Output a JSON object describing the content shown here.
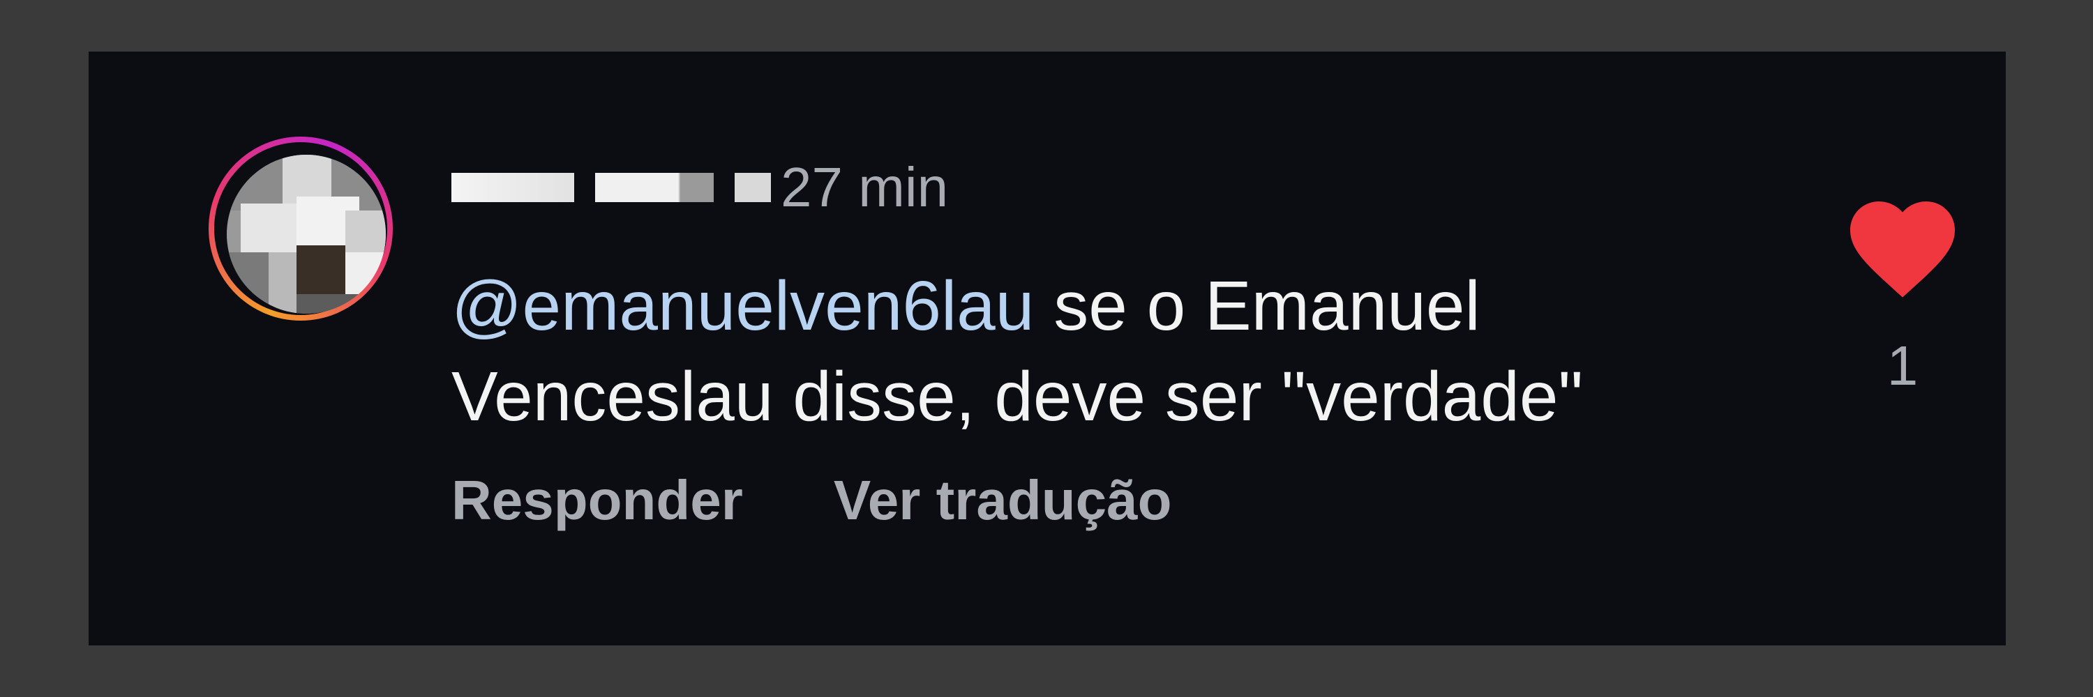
{
  "comment": {
    "timestamp": "27 min",
    "mention": "@emanuelven6lau",
    "text_line1": " se o Emanuel",
    "text_line2": "Venceslau disse, deve ser \"verdade\"",
    "reply_label": "Responder",
    "translate_label": "Ver tradução",
    "like_count": "1"
  },
  "colors": {
    "background": "#0b0d12",
    "mention": "#b8d2f2",
    "heart": "#f0373f",
    "meta_text": "#a8abb2"
  },
  "icons": {
    "like": "heart-icon"
  }
}
